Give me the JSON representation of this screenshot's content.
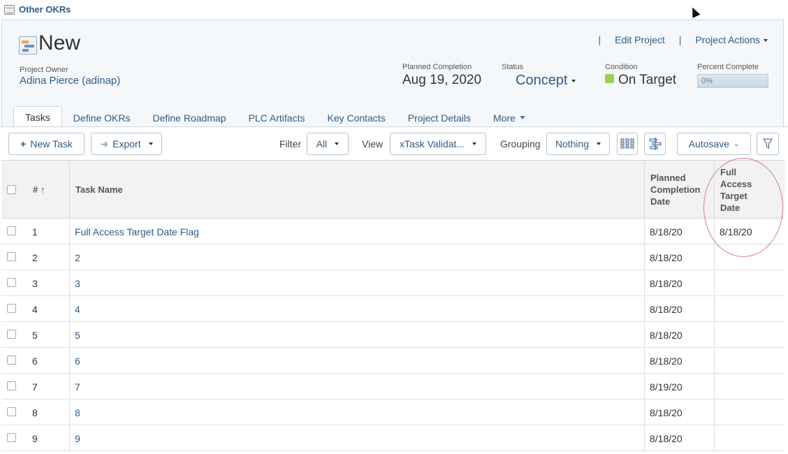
{
  "breadcrumb": {
    "label": "Other OKRs"
  },
  "project": {
    "title": "New",
    "owner_label": "Project Owner",
    "owner": "Adina Pierce (adinap)",
    "planned_completion_label": "Planned Completion",
    "planned_completion": "Aug 19, 2020",
    "status_label": "Status",
    "status": "Concept",
    "condition_label": "Condition",
    "condition": "On Target",
    "condition_color": "#9ad14b",
    "percent_label": "Percent Complete",
    "percent": "0%",
    "percent_value": 0
  },
  "top_actions": {
    "sep1": "|",
    "edit": "Edit Project",
    "sep2": "|",
    "actions": "Project Actions"
  },
  "tabs": [
    {
      "label": "Tasks"
    },
    {
      "label": "Define OKRs"
    },
    {
      "label": "Define Roadmap"
    },
    {
      "label": "PLC Artifacts"
    },
    {
      "label": "Key Contacts"
    },
    {
      "label": "Project Details"
    },
    {
      "label": "More"
    }
  ],
  "toolbar": {
    "new_task": "New Task",
    "export": "Export",
    "filter_label": "Filter",
    "filter_value": "All",
    "view_label": "View",
    "view_value": "xTask Validat...",
    "grouping_label": "Grouping",
    "grouping_value": "Nothing",
    "autosave": "Autosave"
  },
  "table": {
    "headers": {
      "number": "#",
      "name": "Task Name",
      "planned": [
        "Planned",
        "Completion",
        "Date"
      ],
      "full_access": [
        "Full",
        "Access",
        "Target",
        "Date"
      ]
    },
    "rows": [
      {
        "num": "1",
        "name": "Full Access Target Date Flag",
        "planned": "8/18/20",
        "full_access": "8/18/20"
      },
      {
        "num": "2",
        "name": "2",
        "planned": "8/18/20",
        "full_access": ""
      },
      {
        "num": "3",
        "name": "3",
        "planned": "8/18/20",
        "full_access": ""
      },
      {
        "num": "4",
        "name": "4",
        "planned": "8/18/20",
        "full_access": ""
      },
      {
        "num": "5",
        "name": "5",
        "planned": "8/18/20",
        "full_access": ""
      },
      {
        "num": "6",
        "name": "6",
        "planned": "8/18/20",
        "full_access": ""
      },
      {
        "num": "7",
        "name": "7",
        "planned": "8/19/20",
        "full_access": ""
      },
      {
        "num": "8",
        "name": "8",
        "planned": "8/18/20",
        "full_access": ""
      },
      {
        "num": "9",
        "name": "9",
        "planned": "8/18/20",
        "full_access": ""
      }
    ]
  }
}
